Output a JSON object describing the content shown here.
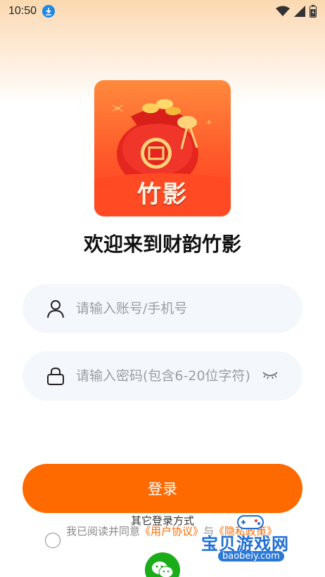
{
  "status_bar": {
    "time": "10:50"
  },
  "logo": {
    "text": "竹影"
  },
  "welcome": "欢迎来到财韵竹影",
  "account_field": {
    "placeholder": "请输入账号/手机号"
  },
  "password_field": {
    "placeholder": "请输入密码(包含6-20位字符)"
  },
  "login_button": "登录",
  "other_login": "其它登录方式",
  "agreement": {
    "prefix": "我已阅读并同意",
    "user_agreement": "《用户协议》",
    "joiner": "与",
    "privacy_policy": "《隐私政策》",
    "checked": false
  },
  "watermark": {
    "title": "宝贝游戏网",
    "domain": "baobeiy.com"
  },
  "colors": {
    "accent": "#ff6a00",
    "wechat": "#1aad19",
    "field_bg": "#f4f7fb"
  }
}
